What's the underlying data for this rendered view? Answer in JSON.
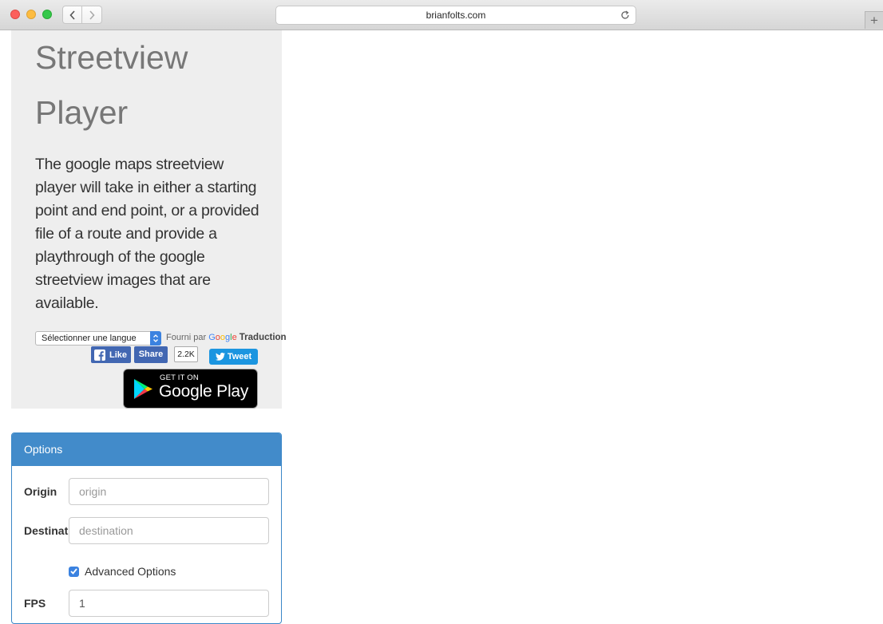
{
  "browser": {
    "url": "brianfolts.com"
  },
  "hero": {
    "title_line1": "Streetview",
    "title_line2": "Player",
    "description": "The google maps streetview player will take in either a starting point and end point, or a provided file of a route and provide a playthrough of the google streetview images that are available."
  },
  "translate": {
    "select_value": "Sélectionner une langue",
    "powered_by": "Fourni par",
    "google": "Google",
    "translation": "Traduction"
  },
  "social": {
    "like_label": "Like",
    "share_label": "Share",
    "share_count": "2.2K",
    "tweet_label": "Tweet"
  },
  "google_play": {
    "get_it_on": "GET IT ON",
    "name": "Google Play"
  },
  "options": {
    "heading": "Options",
    "origin_label": "Origin",
    "origin_placeholder": "origin",
    "destination_label": "Destination",
    "destination_placeholder": "destination",
    "advanced_label": "Advanced Options",
    "advanced_checked": true,
    "fps_label": "FPS",
    "fps_value": "1"
  },
  "colors": {
    "panel_bg": "#eeeeee",
    "options_header": "#428bca",
    "facebook": "#4267b2",
    "twitter": "#1b95e0"
  }
}
